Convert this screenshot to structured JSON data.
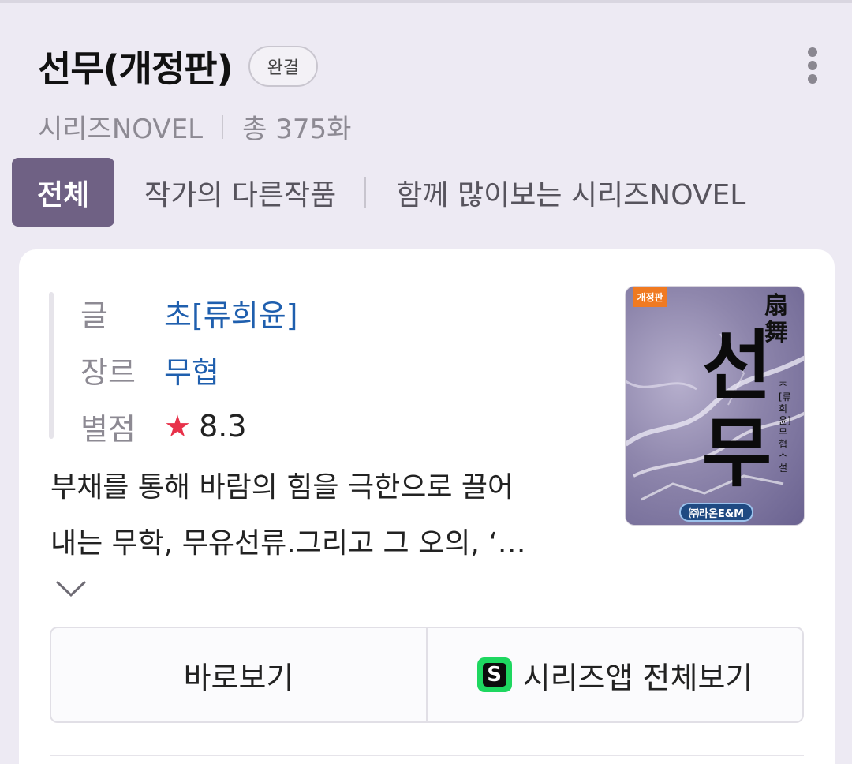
{
  "header": {
    "title": "선무(개정판)",
    "status_badge": "완결",
    "platform": "시리즈NOVEL",
    "episodes": "총 375화"
  },
  "tabs": [
    {
      "label": "전체",
      "active": true
    },
    {
      "label": "작가의 다른작품",
      "active": false
    },
    {
      "label": "함께 많이보는 시리즈NOVEL",
      "active": false
    }
  ],
  "info": {
    "author_label": "글",
    "author_value": "초[류희윤]",
    "genre_label": "장르",
    "genre_value": "무협",
    "rating_label": "별점",
    "rating_value": "8.3"
  },
  "cover": {
    "tag": "개정판",
    "hanja": "扇舞",
    "title": "선무",
    "author": "초[류희윤] 무협소설",
    "publisher": "㈜라온E&M"
  },
  "description": {
    "line1": "부채를 통해 바람의 힘을 극한으로 끌어",
    "line2": "내는 무학, 무유선류.그리고 그 오의, ‘…"
  },
  "buttons": {
    "read_now": "바로보기",
    "app_view": "시리즈앱 전체보기",
    "app_icon_letter": "S"
  },
  "colors": {
    "active_tab": "#6f6184",
    "link": "#1f5fae",
    "star": "#e8324a",
    "app_icon": "#1ed760"
  }
}
